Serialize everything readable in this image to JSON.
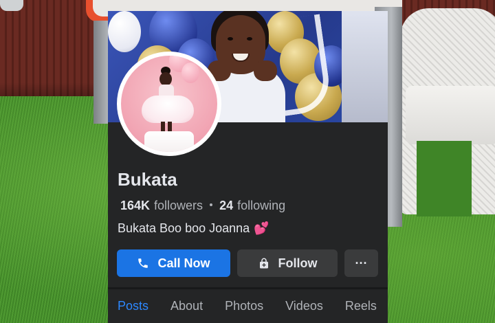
{
  "profile": {
    "name": "Bukata",
    "followers_count": "164K",
    "followers_label": "followers",
    "following_count": "24",
    "following_label": "following",
    "bio": "Bukata Boo boo Joanna",
    "bio_emoji": "💕"
  },
  "actions": {
    "call_label": "Call Now",
    "follow_label": "Follow",
    "more_label": "···"
  },
  "tabs": [
    "Posts",
    "About",
    "Photos",
    "Videos",
    "Reels"
  ],
  "colors": {
    "accent": "#1b74e4",
    "active_tab": "#2d88ff",
    "page_bg": "#242526",
    "button_bg": "#3a3b3c"
  },
  "icons": {
    "call": "phone-icon",
    "follow": "follow-lock-icon",
    "more": "more-dots-icon"
  }
}
